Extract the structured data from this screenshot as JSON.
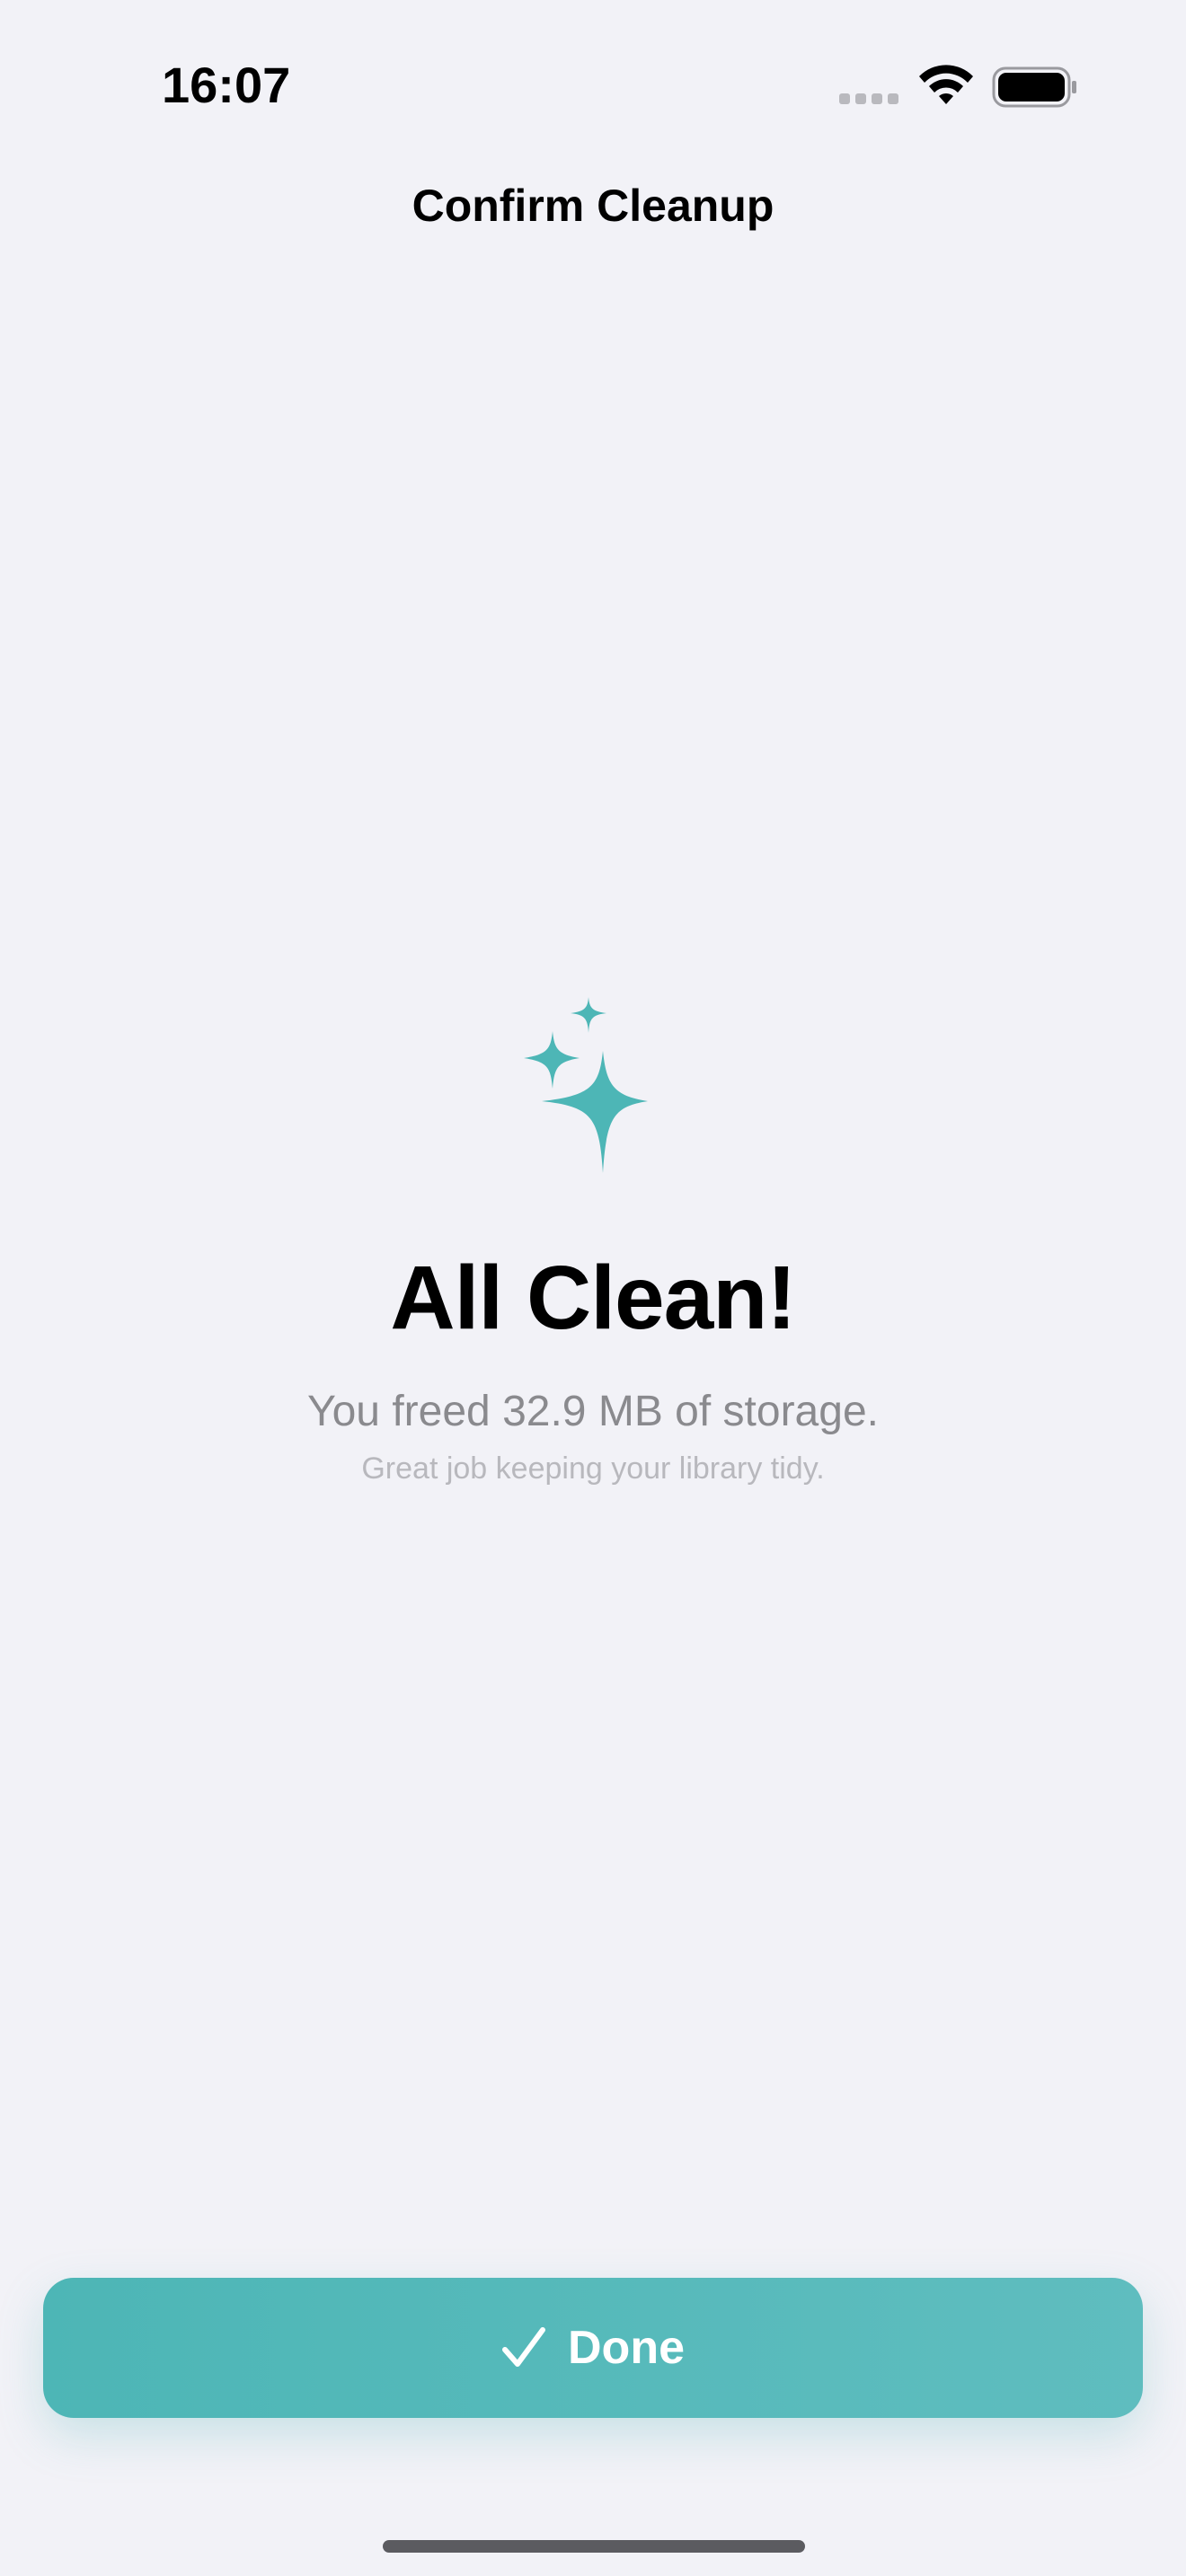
{
  "status_bar": {
    "time": "16:07"
  },
  "nav": {
    "title": "Confirm Cleanup"
  },
  "result": {
    "icon": "sparkles-icon",
    "headline": "All Clean!",
    "freed_message": "You freed 32.9 MB of storage.",
    "tip": "Great job keeping your library tidy."
  },
  "actions": {
    "done_label": "Done",
    "done_icon": "checkmark-icon"
  },
  "colors": {
    "accent": "#4db6b6",
    "background": "#f2f2f7",
    "secondary_text": "#8a8a8e",
    "tertiary_text": "#b8b8bd"
  }
}
